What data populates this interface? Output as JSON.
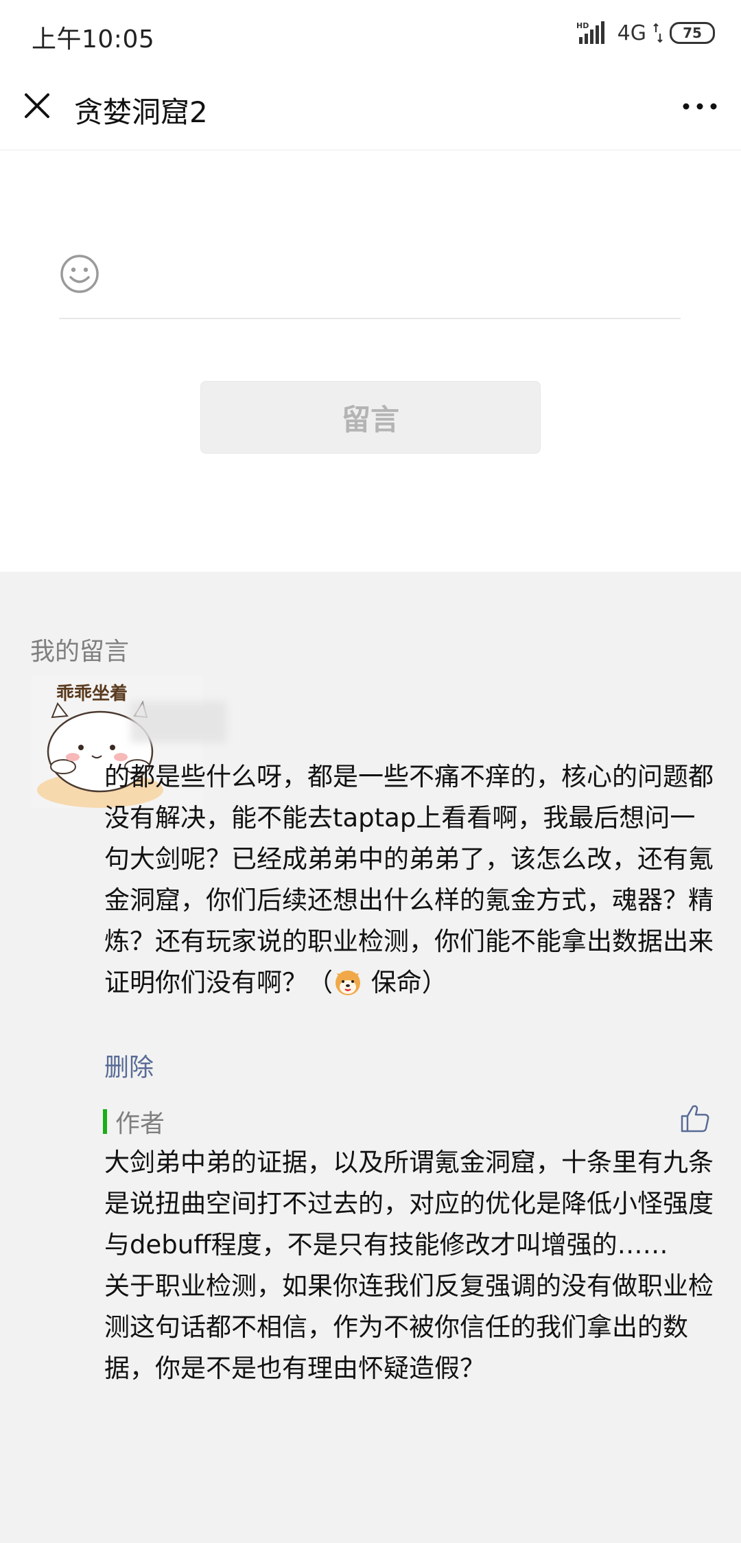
{
  "status_bar": {
    "time": "上午10:05",
    "network": "4G",
    "battery": "75"
  },
  "nav": {
    "title": "贪婪洞窟2",
    "close_icon": "close-icon",
    "more_icon": "more-dots-icon"
  },
  "compose": {
    "placeholder": "",
    "submit_label": "留言",
    "emoji_icon": "smiley-icon"
  },
  "my_comments": {
    "section_label": "我的留言",
    "avatar_caption": "乖乖坐着",
    "comment": {
      "text_before_emoji": "的都是些什么呀，都是一些不痛不痒的，核心的问题都没有解决，能不能去taptap上看看啊，我最后想问一句大剑呢？已经成弟弟中的弟弟了，该怎么改，还有氪金洞窟，你们后续还想出什么样的氪金方式，魂器？精炼？还有玩家说的职业检测，你们能不能拿出数据出来证明你们没有啊？（",
      "text_after_emoji": " 保命）",
      "delete_label": "删除"
    },
    "reply": {
      "author_label": "作者",
      "text": "大剑弟中弟的证据，以及所谓氪金洞窟，十条里有九条是说扭曲空间打不过去的，对应的优化是降低小怪强度与debuff程度，不是只有技能修改才叫增强的……\n关于职业检测，如果你连我们反复强调的没有做职业检测这句话都不相信，作为不被你信任的我们拿出的数据，你是不是也有理由怀疑造假？",
      "like_icon": "thumbs-up-icon"
    }
  },
  "colors": {
    "accent_green": "#1aad19",
    "link_blue": "#576b95"
  }
}
